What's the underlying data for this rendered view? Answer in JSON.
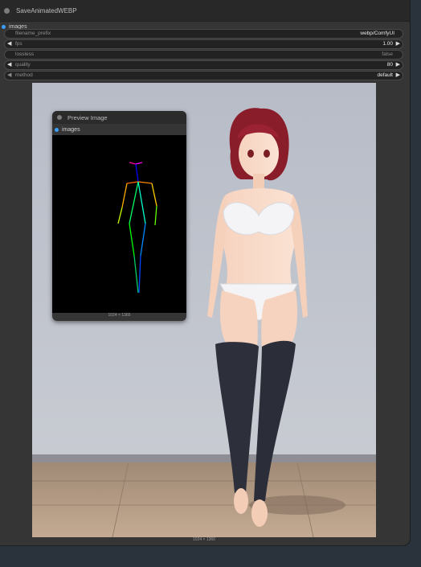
{
  "save_node": {
    "title": "SaveAnimatedWEBP",
    "input_slot": "images",
    "widgets": [
      {
        "label": "filename_prefix",
        "value": "webp/ComfyUI"
      },
      {
        "label": "fps",
        "value": "1.00"
      },
      {
        "label": "lossless",
        "value": "false"
      },
      {
        "label": "quality",
        "value": "80"
      },
      {
        "label": "method",
        "value": "default"
      }
    ],
    "image_caption": "1024 × 1360"
  },
  "preview_node": {
    "title": "Preview Image",
    "input_slot": "images",
    "image_caption": "1024 × 1365"
  },
  "colors": {
    "slot_dot": "#3aa0ff",
    "node_bg": "#353535",
    "canvas_bg": "#2a333c"
  }
}
